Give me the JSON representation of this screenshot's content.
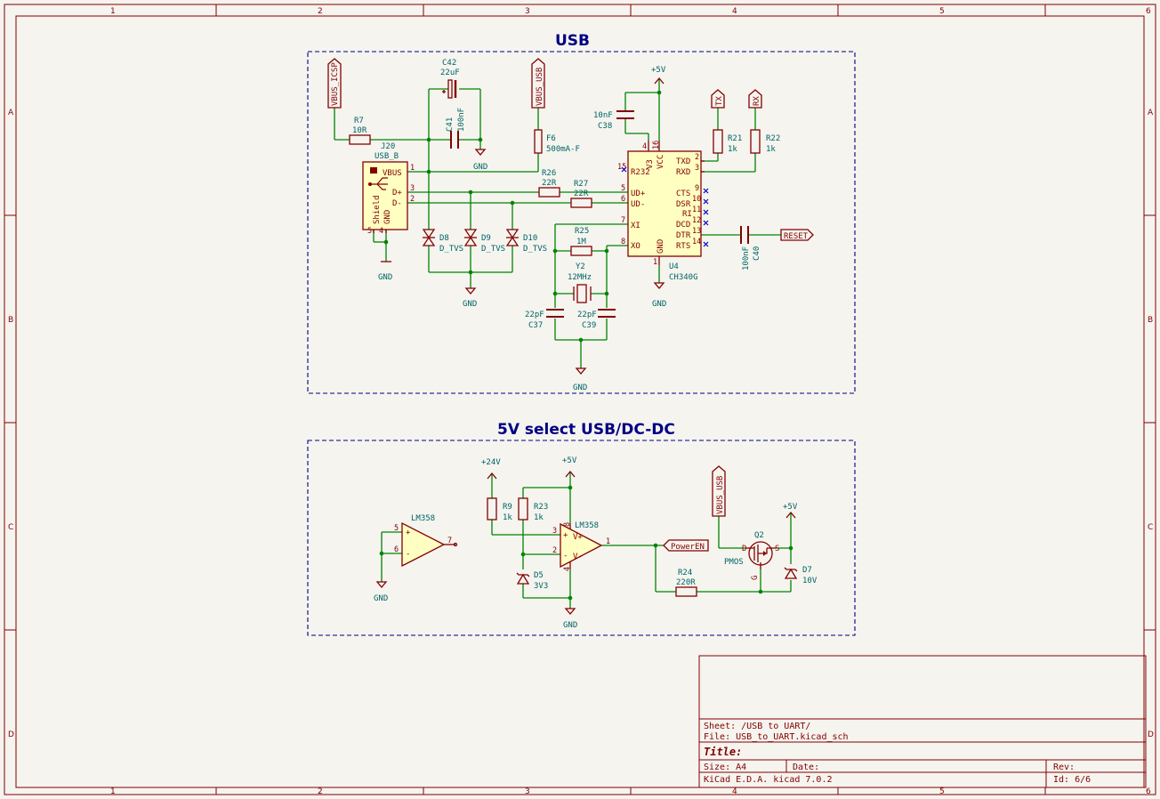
{
  "border": {
    "columns": [
      "1",
      "2",
      "3",
      "4",
      "5",
      "6"
    ],
    "rows": [
      "A",
      "B",
      "C",
      "D"
    ]
  },
  "groups": {
    "usb": "USB",
    "select": "5V select USB/DC-DC"
  },
  "components": {
    "vbus_icsp": "VBUS_ICSP",
    "vbus_usb_top": "VBUS_USB",
    "vbus_usb_bottom": "VBUS_USB",
    "r7_ref": "R7",
    "r7_val": "10R",
    "c42_ref": "C42",
    "c42_val": "22uF",
    "c41_ref": "C41",
    "c41_val": "100nF",
    "f6_ref": "F6",
    "f6_val": "500mA-F",
    "j20_ref": "J20",
    "j20_val": "USB_B",
    "j20_vbus": "VBUS",
    "j20_dp": "D+",
    "j20_dm": "D-",
    "j20_shield": "Shield",
    "j20_gnd": "GND",
    "j20_p1": "1",
    "j20_p3": "3",
    "j20_p2": "2",
    "j20_p5": "5",
    "j20_p4": "4",
    "r26_ref": "R26",
    "r26_val": "22R",
    "r27_ref": "R27",
    "r27_val": "22R",
    "d8_ref": "D8",
    "d8_val": "D_TVS",
    "d9_ref": "D9",
    "d9_val": "D_TVS",
    "d10_ref": "D10",
    "d10_val": "D_TVS",
    "r25_ref": "R25",
    "r25_val": "1M",
    "y2_ref": "Y2",
    "y2_val": "12MHz",
    "c37_ref": "C37",
    "c37_val": "22pF",
    "c39_ref": "C39",
    "c39_val": "22pF",
    "c38_ref": "C38",
    "c38_val": "10nF",
    "u4_ref": "U4",
    "u4_val": "CH340G",
    "u4_r232": "R232",
    "u4_udp": "UD+",
    "u4_udm": "UD-",
    "u4_xi": "XI",
    "u4_xo": "XO",
    "u4_txd": "TXD",
    "u4_rxd": "RXD",
    "u4_cts": "CTS",
    "u4_dsr": "DSR",
    "u4_ri": "RI",
    "u4_dcd": "DCD",
    "u4_dtr": "DTR",
    "u4_rts": "RTS",
    "u4_v3": "V3",
    "u4_vcc": "VCC",
    "u4_gnd": "GND",
    "u4_p15": "15",
    "u4_p5": "5",
    "u4_p6": "6",
    "u4_p7": "7",
    "u4_p8": "8",
    "u4_p2": "2",
    "u4_p3": "3",
    "u4_p9": "9",
    "u4_p10": "10",
    "u4_p11": "11",
    "u4_p12": "12",
    "u4_p13": "13",
    "u4_p14": "14",
    "u4_p4": "4",
    "u4_p16": "16",
    "u4_p1": "1",
    "r21_ref": "R21",
    "r21_val": "1k",
    "r22_ref": "R22",
    "r22_val": "1k",
    "tx": "TX",
    "rx": "RX",
    "c40_ref": "C40",
    "c40_val": "100nF",
    "reset": "RESET",
    "lm358a_ref": "LM358",
    "lm358a_p5": "5",
    "lm358a_p6": "6",
    "lm358a_p7": "7",
    "r9_ref": "R9",
    "r9_val": "1k",
    "r23_ref": "R23",
    "r23_val": "1k",
    "d5_ref": "D5",
    "d5_val": "3V3",
    "lm358b_ref": "LM358",
    "lm358b_p3": "3",
    "lm358b_p2": "2",
    "lm358b_p8": "8",
    "lm358b_p4": "4",
    "lm358b_p1": "1",
    "powereN": "PowerEN",
    "r24_ref": "R24",
    "r24_val": "220R",
    "q2_ref": "Q2",
    "q2_val": "PMOS",
    "q2_d": "D",
    "q2_s": "S",
    "q2_g": "G",
    "d7_ref": "D7",
    "d7_val": "10V"
  },
  "power": {
    "p5v": "+5V",
    "p24v": "+24V",
    "gnd": "GND"
  },
  "title_block": {
    "sheet": "Sheet: /USB to UART/",
    "file": "File: USB_to_UART.kicad_sch",
    "title": "Title:",
    "size": "Size: A4",
    "date": "Date:",
    "rev": "Rev:",
    "tool": "KiCad E.D.A.  kicad 7.0.2",
    "id": "Id: 6/6"
  }
}
